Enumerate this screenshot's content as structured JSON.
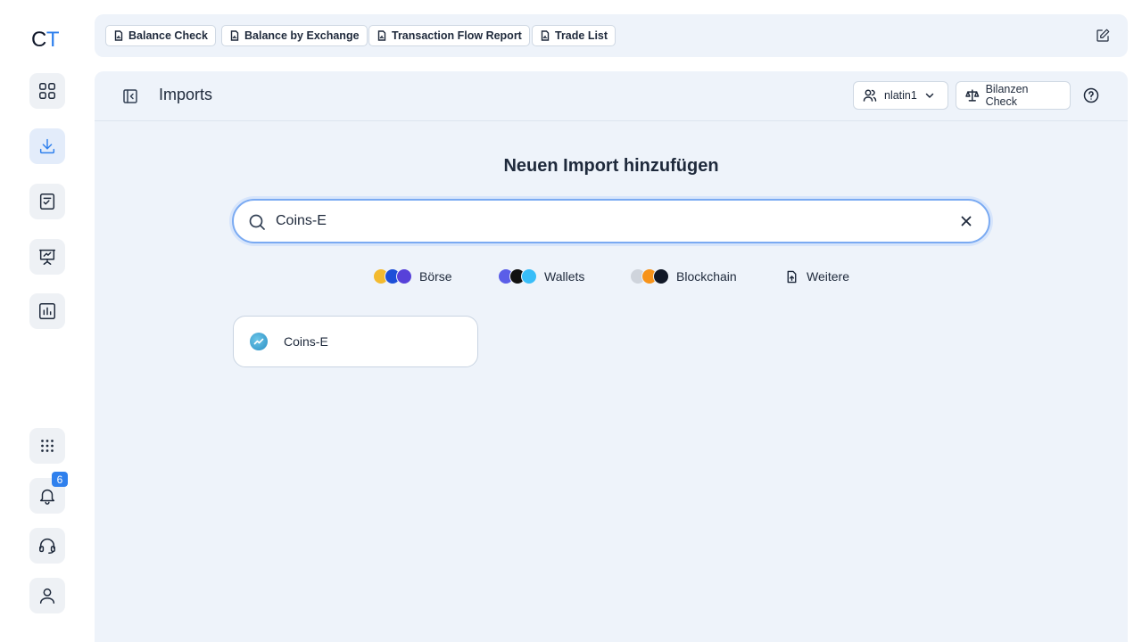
{
  "app": {
    "logo_c": "C",
    "logo_t": "T",
    "accent_color": "#2f80ed"
  },
  "rail": {
    "items": [
      {
        "icon": "dashboard-grid-icon"
      },
      {
        "icon": "download-icon",
        "active": true
      },
      {
        "icon": "checklist-icon"
      },
      {
        "icon": "presentation-icon"
      },
      {
        "icon": "bar-chart-icon"
      }
    ],
    "bottom": [
      {
        "icon": "apps-grid-icon"
      },
      {
        "icon": "bell-icon",
        "badge": "6"
      },
      {
        "icon": "headset-icon"
      },
      {
        "icon": "user-icon"
      }
    ]
  },
  "tabs": [
    {
      "label": "Balance Check",
      "icon": "report-file-icon"
    },
    {
      "label": "Balance by Exchange",
      "icon": "report-file-icon"
    },
    {
      "label": "Transaction Flow Report",
      "icon": "report-file-icon"
    },
    {
      "label": "Trade List",
      "icon": "report-file-icon"
    }
  ],
  "header": {
    "title": "Imports",
    "user_label": "nlatin1",
    "balance_check_label": "Bilanzen Check"
  },
  "content": {
    "heading": "Neuen Import hinzufügen",
    "search": {
      "value": "Coins-E",
      "placeholder": ""
    },
    "categories": [
      {
        "label": "Börse",
        "icon": "exchange-logos-icon"
      },
      {
        "label": "Wallets",
        "icon": "wallet-logos-icon"
      },
      {
        "label": "Blockchain",
        "icon": "blockchain-logos-icon"
      },
      {
        "label": "Weitere",
        "icon": "file-upload-icon"
      }
    ],
    "results": [
      {
        "label": "Coins-E",
        "icon": "coins-e-logo-icon"
      }
    ]
  }
}
